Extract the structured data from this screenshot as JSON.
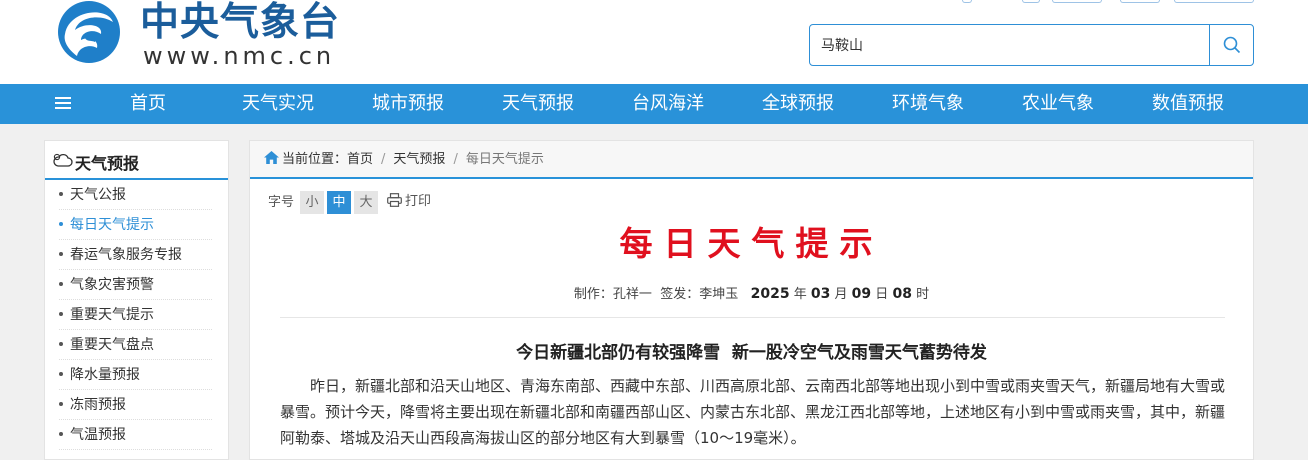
{
  "header": {
    "logo_text": "中央气象台",
    "logo_url": "www.nmc.cn"
  },
  "search": {
    "value": "马鞍山",
    "icon": "search-icon"
  },
  "nav": {
    "menu_icon": "hamburger-icon",
    "items": [
      "首页",
      "天气实况",
      "城市预报",
      "天气预报",
      "台风海洋",
      "全球预报",
      "环境气象",
      "农业气象",
      "数值预报"
    ]
  },
  "sidebar": {
    "title": "天气预报",
    "icon": "cloud-icon",
    "items": [
      "天气公报",
      "每日天气提示",
      "春运气象服务专报",
      "气象灾害预警",
      "重要天气提示",
      "重要天气盘点",
      "降水量预报",
      "冻雨预报",
      "气温预报"
    ],
    "active_index": 1
  },
  "breadcrumb": {
    "prefix": "当前位置：",
    "items": [
      "首页",
      "天气预报",
      "每日天气提示"
    ]
  },
  "tools": {
    "font_label": "字号",
    "sizes": [
      "小",
      "中",
      "大"
    ],
    "active_size": "中",
    "print_label": "打印"
  },
  "article": {
    "title": "每日天气提示",
    "meta": {
      "author_label": "制作：",
      "author": "孔祥一",
      "signer_label": "签发：",
      "signer": "李坤玉",
      "year": "2025",
      "year_unit": "年",
      "month": "03",
      "month_unit": "月",
      "day": "09",
      "day_unit": "日",
      "hour": "08",
      "hour_unit": "时"
    },
    "subtitle": "今日新疆北部仍有较强降雪  新一股冷空气及雨雪天气蓄势待发",
    "paragraph": "昨日，新疆北部和沿天山地区、青海东南部、西藏中东部、川西高原北部、云南西北部等地出现小到中雪或雨夹雪天气，新疆局地有大雪或暴雪。预计今天，降雪将主要出现在新疆北部和南疆西部山区、内蒙古东北部、黑龙江西北部等地，上述地区有小到中雪或雨夹雪，其中，新疆阿勒泰、塔城及沿天山西段高海拔山区的部分地区有大到暴雪（10～19毫米）。"
  },
  "colors": {
    "nav_bg": "#2992d9",
    "title_red": "#e0101e",
    "logo_blue": "#1b5d9b",
    "link_blue": "#2e8fd6"
  }
}
